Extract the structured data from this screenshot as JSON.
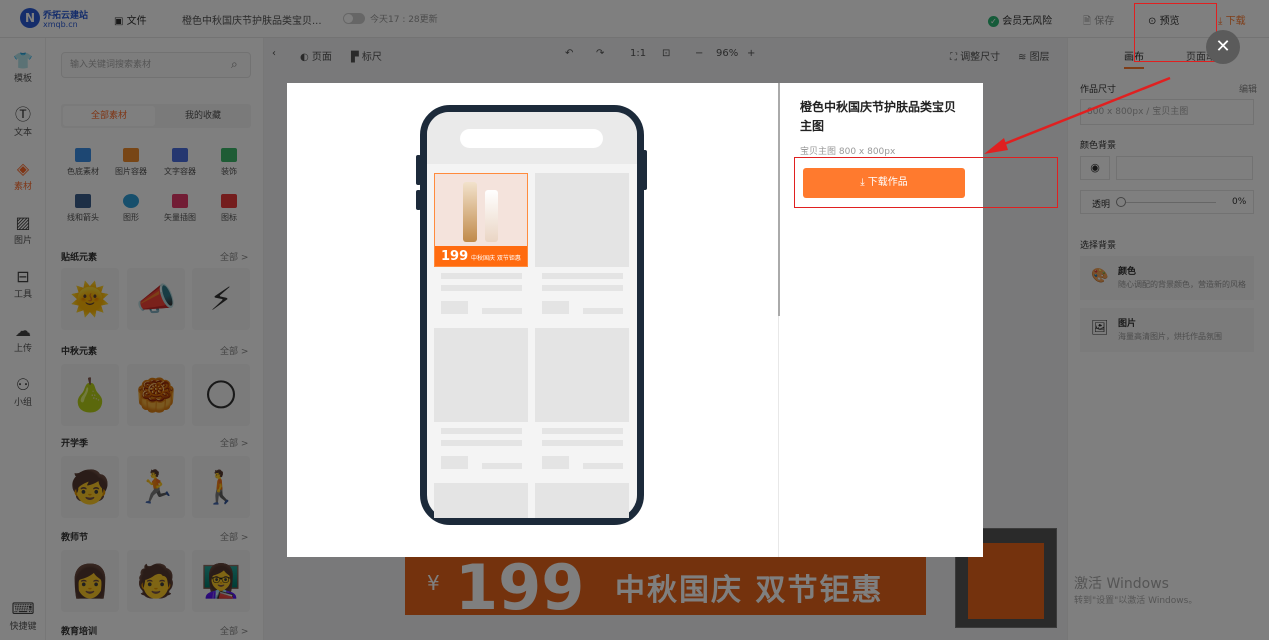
{
  "topbar": {
    "logo_n": "N",
    "logo_line1": "乔拓云建站",
    "logo_line2": "xmqb.cn",
    "file_label": "文件",
    "doc_title": "橙色中秋国庆节护肤品类宝贝...",
    "saved_time": "今天17 : 28更新",
    "member_label": "会员无风险",
    "save_label": "保存",
    "preview_label": "预览",
    "download_label": "下载"
  },
  "left_nav": [
    {
      "icon": "T-shirt-icon",
      "label": "模板"
    },
    {
      "icon": "text-icon",
      "label": "文本"
    },
    {
      "icon": "material-icon",
      "label": "素材"
    },
    {
      "icon": "image-icon",
      "label": "图片"
    },
    {
      "icon": "toolbox-icon",
      "label": "工具"
    },
    {
      "icon": "upload-icon",
      "label": "上传"
    },
    {
      "icon": "group-icon",
      "label": "小组"
    },
    {
      "icon": "keyboard-icon",
      "label": "快捷键"
    }
  ],
  "panel": {
    "search_placeholder": "输入关键词搜索素材",
    "tab_all": "全部素材",
    "tab_fav": "我的收藏",
    "categories": [
      "色底素材",
      "图片容器",
      "文字容器",
      "装饰",
      "线和箭头",
      "图形",
      "矢量插图",
      "图标"
    ],
    "sections": [
      {
        "title": "贴纸元素",
        "all": "全部 >"
      },
      {
        "title": "中秋元素",
        "all": "全部 >"
      },
      {
        "title": "开学季",
        "all": "全部 >"
      },
      {
        "title": "教师节",
        "all": "全部 >"
      },
      {
        "title": "教育培训",
        "all": "全部 >"
      }
    ]
  },
  "canvas_bar": {
    "page_label": "页面",
    "ruler_label": "标尺",
    "ratio": "1:1",
    "zoom": "96%",
    "resize_label": "调整尺寸",
    "layers_label": "图层"
  },
  "right_panel": {
    "tab_canvas": "画布",
    "tab_page": "页面动画",
    "size_label": "作品尺寸",
    "edit_label": "编辑",
    "size_value": "800 x 800px  / 宝贝主图",
    "bgcolor_label": "颜色背景",
    "opacity_label": "透明",
    "opacity_value": "0%",
    "choose_bg_label": "选择背景",
    "bg_color_title": "颜色",
    "bg_color_desc": "随心调配的背景颜色，营造新的风格",
    "bg_image_title": "图片",
    "bg_image_desc": "海量高清图片，烘托作品氛围"
  },
  "modal": {
    "title": "橙色中秋国庆节护肤品类宝贝主图",
    "subtitle": "宝贝主图 800 x 800px",
    "download_button": "下载作品",
    "product_price": "199",
    "product_tag": "中秋国庆 双节钜惠"
  },
  "banner": {
    "price": "199",
    "currency": "¥",
    "slogan": "中秋国庆 双节钜惠"
  },
  "windows": {
    "line1": "激活 Windows",
    "line2": "转到\"设置\"以激活 Windows。"
  },
  "colors": {
    "accent": "#ff7a2e",
    "annotation_red": "#e02020",
    "brand_blue": "#2a5bd7"
  }
}
